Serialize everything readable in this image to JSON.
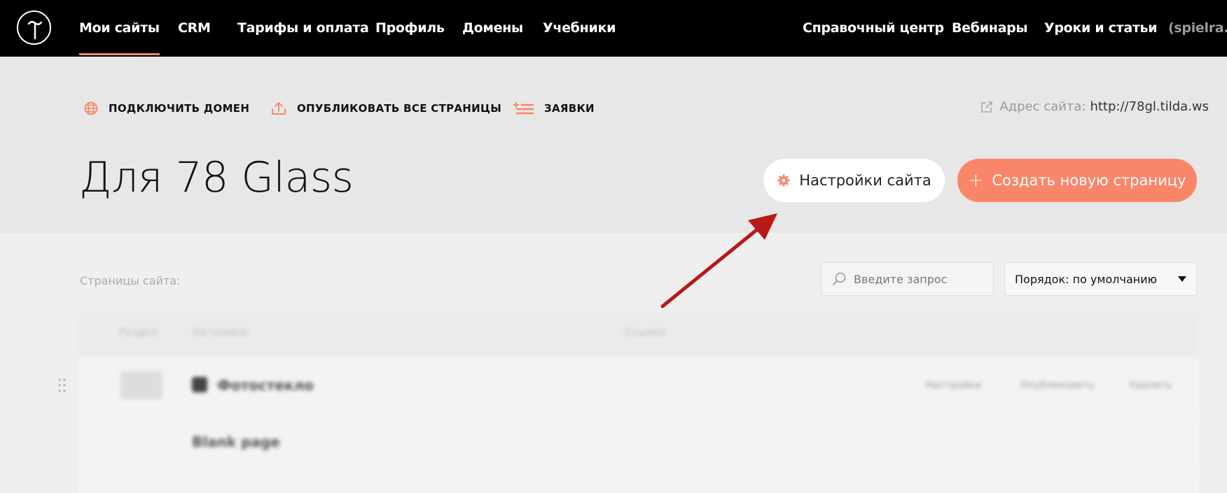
{
  "nav": {
    "items": [
      {
        "label": "Мои сайты",
        "active": true
      },
      {
        "label": "CRM"
      },
      {
        "label": "Тарифы и оплата"
      },
      {
        "label": "Профиль"
      },
      {
        "label": "Домены"
      },
      {
        "label": "Учебники"
      }
    ],
    "right_items": [
      {
        "label": "Справочный центр"
      },
      {
        "label": "Вебинары"
      },
      {
        "label": "Уроки и статьи"
      }
    ],
    "user": "(spielra..)"
  },
  "actions": {
    "connect_domain": "ПОДКЛЮЧИТЬ ДОМЕН",
    "publish_all": "ОПУБЛИКОВАТЬ ВСЕ СТРАНИЦЫ",
    "requests": "ЗАЯВКИ"
  },
  "site": {
    "address_label": "Адрес сайта:",
    "address_url": "http://78gl.tilda.ws",
    "title": "Для 78 Glass"
  },
  "buttons": {
    "settings": "Настройки сайта",
    "create_plus": "+",
    "create": "Создать новую страницу"
  },
  "content": {
    "pages_label": "Страницы сайта:",
    "search_placeholder": "Введите запрос",
    "sort_label": "Порядок: по умолчанию"
  },
  "table": {
    "headers": [
      "Раздел",
      "Заголовок",
      "Ссылка"
    ],
    "rows": [
      {
        "name": "Фотостекло",
        "actions": [
          "Настройки",
          "Опубликовать",
          "Удалить"
        ]
      },
      {
        "name": "Blank page"
      }
    ]
  },
  "colors": {
    "accent": "#fa8669",
    "nav_bg": "#000000",
    "header_bg": "#e7e7e7",
    "arrow": "#b81818"
  }
}
